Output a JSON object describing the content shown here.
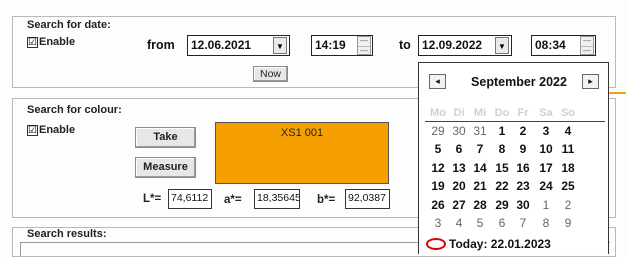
{
  "date_search": {
    "title": "Search for date:",
    "enable_label": "Enable",
    "enable_checked": "☑",
    "from_label": "from",
    "from_date": "12.06.2021",
    "from_time": "14:19",
    "to_label": "to",
    "to_date": "12.09.2022",
    "to_time": "08:34",
    "now_button": "Now"
  },
  "colour_search": {
    "title": "Search for colour:",
    "enable_label": "Enable",
    "take_button": "Take",
    "measure_button": "Measure",
    "swatch_label": "XS1 001",
    "swatch_color": "#f5a000",
    "l_label": "L*=",
    "l_value": "74,6112",
    "a_label": "a*=",
    "a_value": "18,35645",
    "b_label": "b*=",
    "b_value": "92,0387"
  },
  "results": {
    "title": "Search results:"
  },
  "calendar": {
    "month_title": "September 2022",
    "prev_icon": "◂",
    "next_icon": "▸",
    "weekdays": [
      "Mo",
      "Di",
      "Mi",
      "Do",
      "Fr",
      "Sa",
      "So"
    ],
    "weeks": [
      [
        "29",
        "30",
        "31",
        "1",
        "2",
        "3",
        "4"
      ],
      [
        "5",
        "6",
        "7",
        "8",
        "9",
        "10",
        "11"
      ],
      [
        "12",
        "13",
        "14",
        "15",
        "16",
        "17",
        "18"
      ],
      [
        "19",
        "20",
        "21",
        "22",
        "23",
        "24",
        "25"
      ],
      [
        "26",
        "27",
        "28",
        "29",
        "30",
        "1",
        "2"
      ],
      [
        "3",
        "4",
        "5",
        "6",
        "7",
        "8",
        "9"
      ]
    ],
    "today_label": "Today: 22.01.2023",
    "today_marker_color": "#e00000"
  }
}
